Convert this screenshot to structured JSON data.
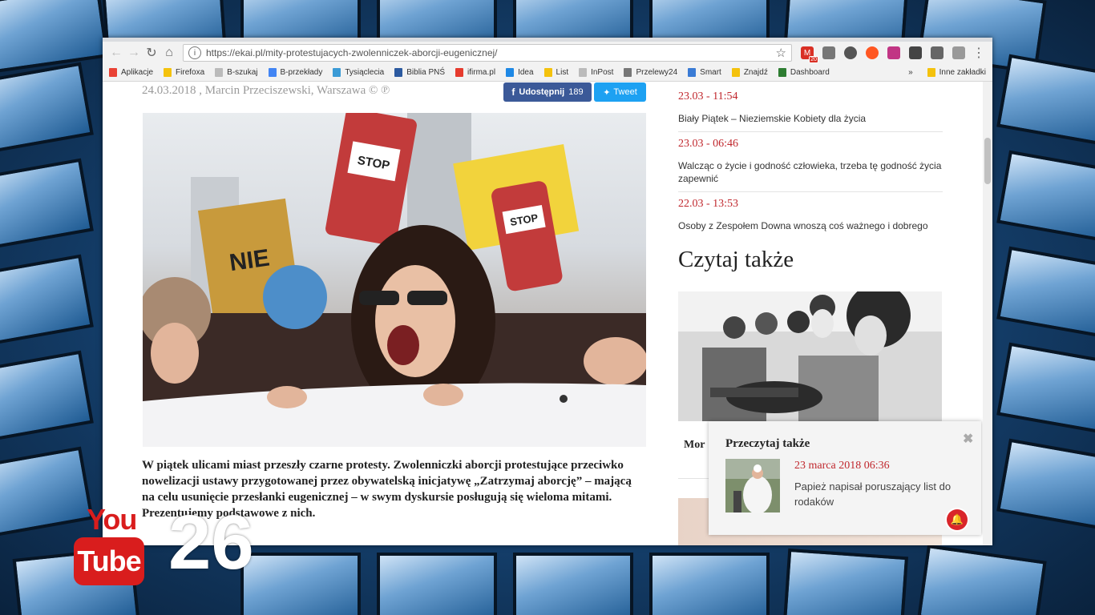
{
  "browser": {
    "url": "https://ekai.pl/mity-protestujacych-zwolenniczek-aborcji-eugenicznej/",
    "gmail_badge": "20",
    "bookmarks": [
      {
        "label": "Aplikacje",
        "color": "#e94235"
      },
      {
        "label": "Firefoxa",
        "color": "#f4c20d"
      },
      {
        "label": "B-szukaj",
        "color": "#bbbbbb"
      },
      {
        "label": "B-przekłady",
        "color": "#4285f4"
      },
      {
        "label": "Tysiąclecia",
        "color": "#3b9bd6"
      },
      {
        "label": "Biblia PNŚ",
        "color": "#2c5aa0"
      },
      {
        "label": "ifirma.pl",
        "color": "#e63b2e"
      },
      {
        "label": "Idea",
        "color": "#1e88e5"
      },
      {
        "label": "List",
        "color": "#f4c20d"
      },
      {
        "label": "InPost",
        "color": "#bbbbbb"
      },
      {
        "label": "Przelewy24",
        "color": "#777777"
      },
      {
        "label": "Smart",
        "color": "#3a7bd5"
      },
      {
        "label": "Znajdź",
        "color": "#f4c20d"
      },
      {
        "label": "Dashboard",
        "color": "#2e7d32"
      }
    ],
    "bookmarks_overflow": "»",
    "other_bookmarks": "Inne zakładki"
  },
  "article": {
    "byline": "24.03.2018 , Marcin Przeciszewski, Warszawa © ℗",
    "share_label": "Udostępnij",
    "share_count": "189",
    "tweet_label": "Tweet",
    "sign_left": "NIE",
    "sign_center": "STOP",
    "sign_right": "STOP",
    "lead": "W piątek ulicami miast przeszły czarne protesty. Zwolenniczki aborcji protestujące przeciwko nowelizacji ustawy przygotowanej przez obywatelską inicjatywę „Zatrzymaj aborcję” – mającą na celu usunięcie przesłanki eugenicznej – w swym dyskursie posługują się wieloma mitami. Prezentujemy podstawowe z nich."
  },
  "sidebar": {
    "news": [
      {
        "time": "23.03 - 11:54",
        "title": "Biały Piątek – Nieziemskie Kobiety dla życia"
      },
      {
        "time": "23.03 - 06:46",
        "title": "Walcząc o życie i godność człowieka, trzeba tę godność życia zapewnić"
      },
      {
        "time": "22.03 - 13:53",
        "title": "Osoby z Zespołem Downa wnoszą coś ważnego i dobrego"
      }
    ],
    "read_also_heading": "Czytaj także",
    "card_title_fragment": "Mor"
  },
  "popup": {
    "title": "Przeczytaj także",
    "close": "✖",
    "date": "23 marca 2018 06:36",
    "text": "Papież napisał poruszający list do rodaków"
  },
  "watermark": {
    "you": "You",
    "tube": "Tube",
    "number": "26"
  }
}
